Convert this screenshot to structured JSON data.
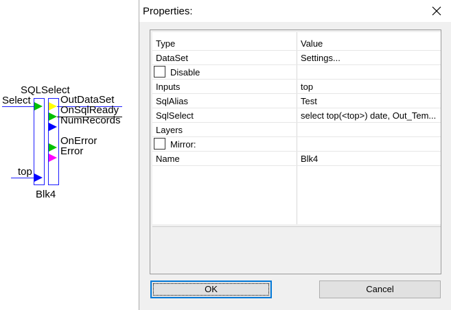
{
  "diagram": {
    "block_title": "SQLSelect",
    "block_name": "Blk4",
    "inputs": [
      {
        "label": "Select",
        "color": "#00c000"
      },
      {
        "label": "top",
        "color": "#0000ff"
      }
    ],
    "outputs": [
      {
        "label": "OutDataSet",
        "color": "#ffff00"
      },
      {
        "label": "OnSqlReady",
        "color": "#00c000"
      },
      {
        "label": "NumRecords",
        "color": "#0000ff"
      },
      {
        "label": "OnError",
        "color": "#00c000"
      },
      {
        "label": "Error",
        "color": "#ff00ff"
      }
    ]
  },
  "dialog": {
    "title": "Properties:",
    "header": {
      "name": "Type",
      "value": "Value"
    },
    "rows": [
      {
        "name": "DataSet",
        "value": "Settings..."
      },
      {
        "name": "Disable",
        "value": "",
        "checkbox": true,
        "checked": false
      },
      {
        "name": "Inputs",
        "value": "top"
      },
      {
        "name": "SqlAlias",
        "value": "Test"
      },
      {
        "name": "SqlSelect",
        "value": "select top(<top>) date, Out_Tem..."
      },
      {
        "name": "Layers",
        "value": ""
      },
      {
        "name": "Mirror:",
        "value": "",
        "checkbox": true,
        "checked": false
      },
      {
        "name": "Name",
        "value": "Blk4"
      }
    ],
    "ok_label": "OK",
    "cancel_label": "Cancel"
  }
}
